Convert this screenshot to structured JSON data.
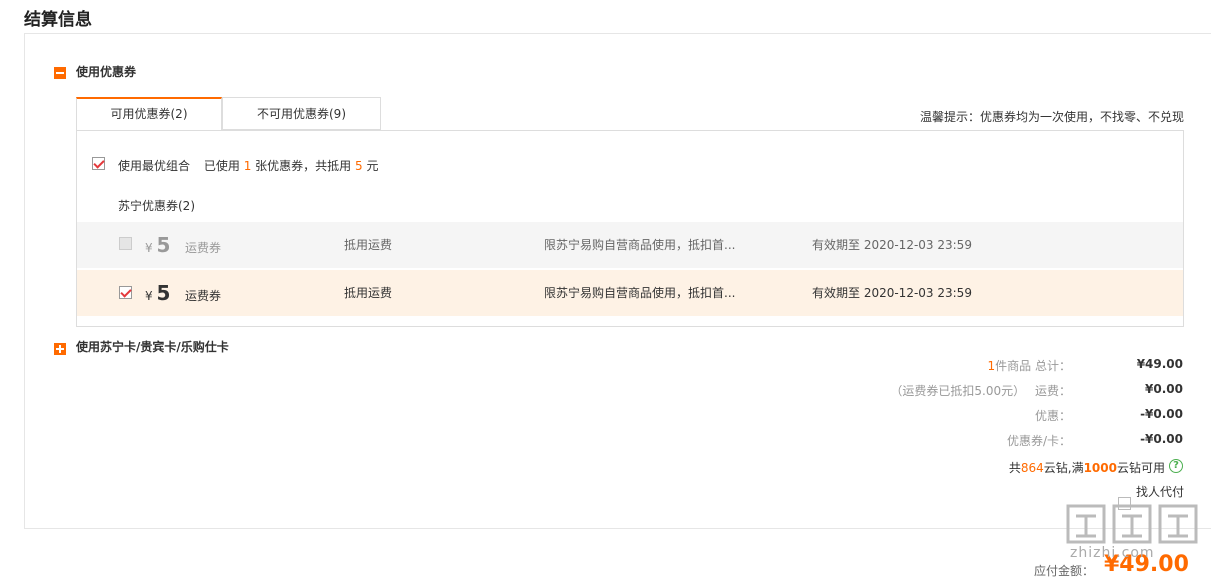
{
  "page": {
    "title": "结算信息"
  },
  "coupon_section": {
    "label": "使用优惠券",
    "tabs": [
      {
        "label": "可用优惠券(2)"
      },
      {
        "label": "不可用优惠券(9)"
      }
    ],
    "tip": "温馨提示：优惠券均为一次使用，不找零、不兑现",
    "best_combo": {
      "checkbox_label": "使用最优组合",
      "used_prefix": "已使用",
      "used_count": "1",
      "used_mid": "张优惠券，共抵用",
      "used_amount": "5",
      "used_suffix": "元"
    },
    "group_label": "苏宁优惠券(2)",
    "coupons": [
      {
        "currency": "¥",
        "amount": "5",
        "type": "运费券",
        "use": "抵用运费",
        "desc": "限苏宁易购自营商品使用，抵扣首...",
        "validity": "有效期至 2020-12-03 23:59",
        "checked": false
      },
      {
        "currency": "¥",
        "amount": "5",
        "type": "运费券",
        "use": "抵用运费",
        "desc": "限苏宁易购自营商品使用，抵扣首...",
        "validity": "有效期至 2020-12-03 23:59",
        "checked": true
      }
    ]
  },
  "card_section": {
    "label": "使用苏宁卡/贵宾卡/乐购仕卡"
  },
  "summary": {
    "items_count": "1",
    "items_label": "件商品 总计：",
    "items_total": "¥49.00",
    "shipping_note": "（运费券已抵扣5.00元）",
    "shipping_label": "运费：",
    "shipping_value": "¥0.00",
    "discount_label": "优惠：",
    "discount_value": "-¥0.00",
    "coupon_card_label": "优惠券/卡：",
    "coupon_card_value": "-¥0.00",
    "yunzuan_prefix": "共",
    "yunzuan_count": "864",
    "yunzuan_mid": "云钻,满",
    "yunzuan_threshold": "1000",
    "yunzuan_suffix": "云钻可用",
    "proxy_pay_label": "找人代付",
    "payable_label": "应付金额：",
    "payable_value": "¥49.00"
  },
  "watermark": {
    "site": "zhizhi.com"
  },
  "colors": {
    "accent": "#ff6a00",
    "selected_row_bg": "#fef2e5",
    "help_icon": "#4caf50"
  }
}
